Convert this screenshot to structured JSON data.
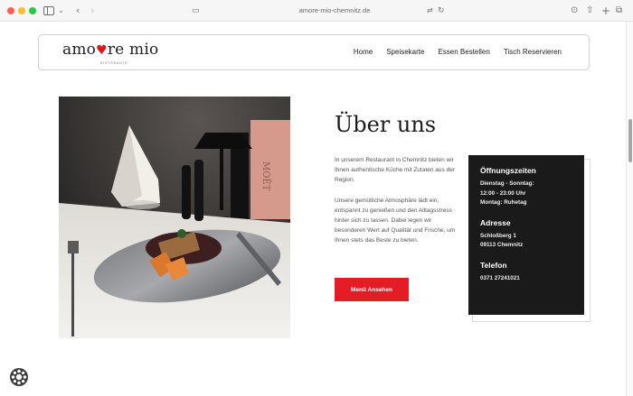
{
  "browser": {
    "url": "amore-mio-chemnitz.de"
  },
  "navbar": {
    "logo_part1": "amo",
    "logo_part2": "re mio",
    "logo_sub": "RISTORANTE",
    "links": [
      "Home",
      "Speisekarte",
      "Essen Bestellen",
      "Tisch Reservieren"
    ]
  },
  "about": {
    "title": "Über uns",
    "paragraph1": "In unserem Restaurant in Chemnitz bieten wir Ihnen authentische Küche mit Zutaten aus der Region.",
    "paragraph2": "Unsere gemütliche Atmosphäre lädt ein, entspannt zu genießen und den Alltagsstress hinter sich zu lassen. Dabei legen wir besonderen Wert auf Qualität und Frische, um Ihnen stets das Beste zu bieten.",
    "button_label": "Menü Ansehen"
  },
  "info": {
    "hours_title": "Öffnungszeiten",
    "hours_line1": "Dienstag - Sonntag:",
    "hours_line2": "12:00 - 23:00 Uhr",
    "hours_line3": "Montag: Ruhetag",
    "address_title": "Adresse",
    "address_line1": "Schloßberg 1",
    "address_line2": "09113 Chemnitz",
    "phone_title": "Telefon",
    "phone": "0371 27241021"
  },
  "photo": {
    "bottle_label": "MOËT"
  },
  "colors": {
    "accent": "#e31c25",
    "heart": "#d71920",
    "info_bg": "#1a1a1a"
  }
}
